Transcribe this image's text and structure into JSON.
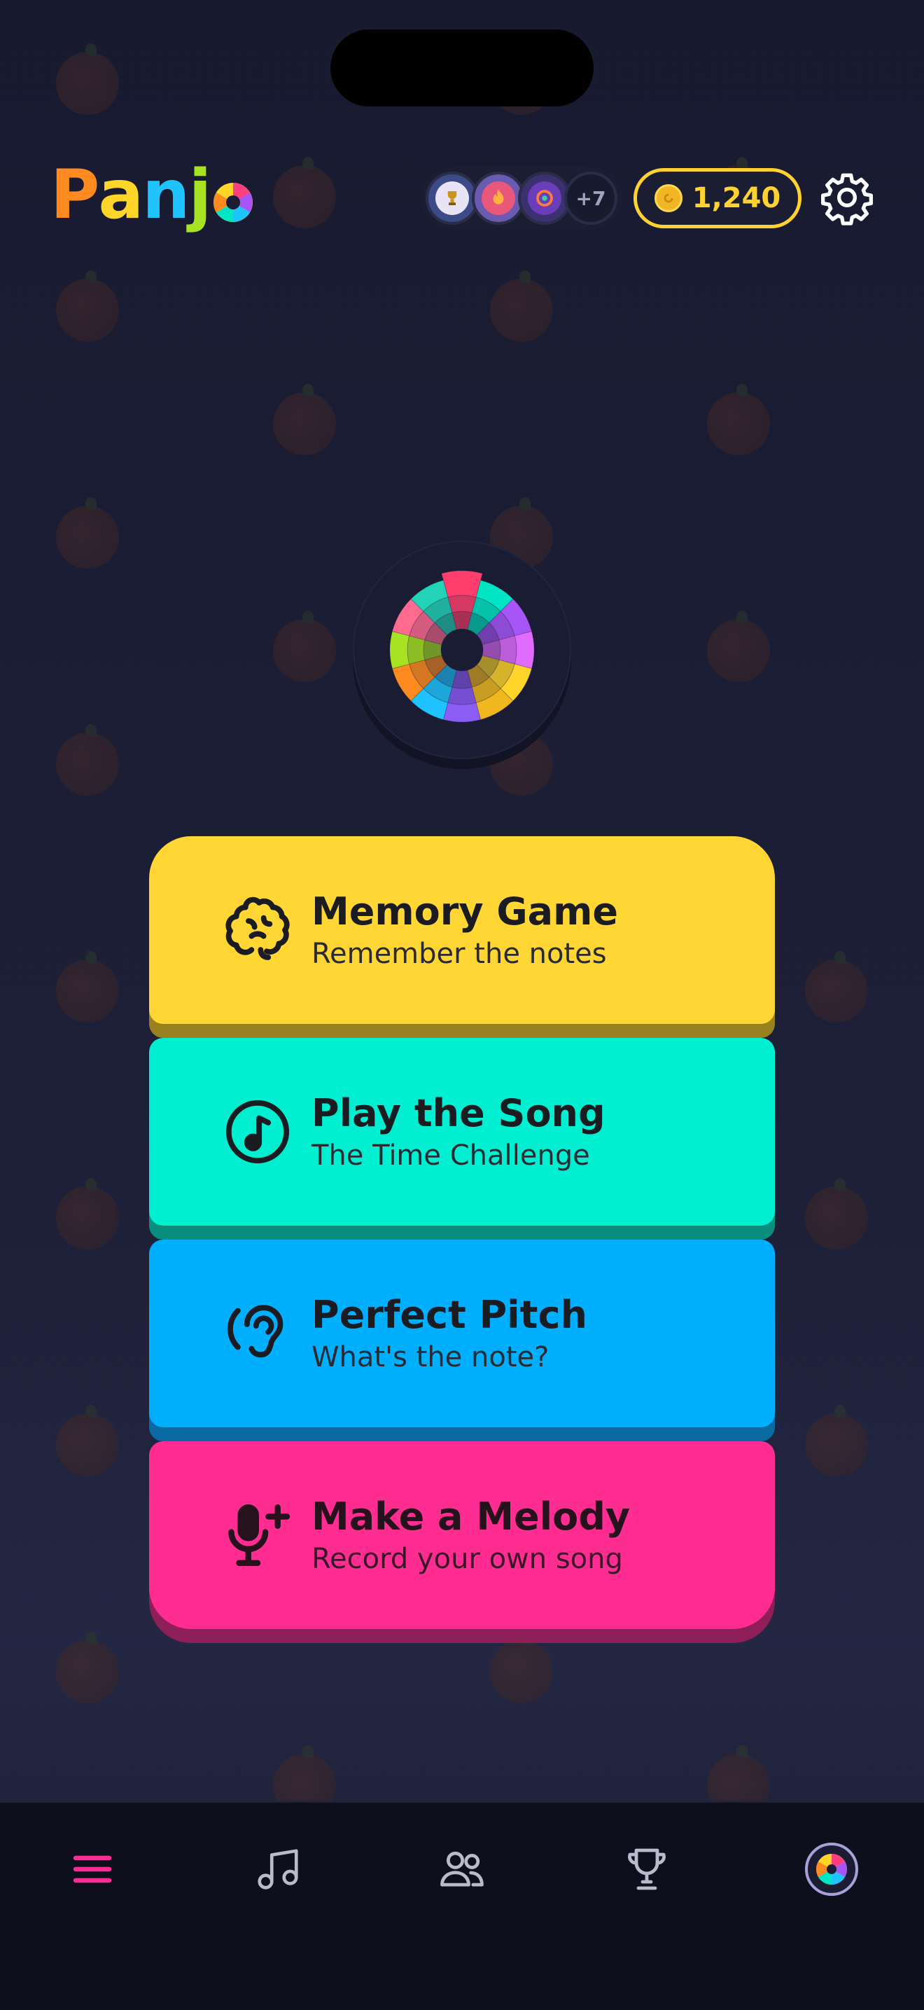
{
  "app": {
    "name": "Panjo",
    "logo_letters": [
      "P",
      "a",
      "n",
      "j"
    ]
  },
  "colors": {
    "background": "#1d2038",
    "accent_yellow": "#ffd634",
    "accent_teal": "#00efd1",
    "accent_blue": "#00b0ff",
    "accent_pink": "#ff2d92",
    "tab_active": "#ff2d92"
  },
  "header": {
    "badges": [
      {
        "icon": "trophy-badge-icon"
      },
      {
        "icon": "flame-badge-icon"
      },
      {
        "icon": "medal-badge-icon"
      }
    ],
    "badges_more": "+7",
    "coins": "1,240",
    "settings_icon": "gear-icon"
  },
  "center": {
    "icon": "color-wheel-icon"
  },
  "modes": [
    {
      "title": "Memory Game",
      "subtitle": "Remember the notes",
      "icon": "brain-icon",
      "color": "#ffd634"
    },
    {
      "title": "Play the Song",
      "subtitle": "The Time Challenge",
      "icon": "music-note-circle-icon",
      "color": "#00efd1"
    },
    {
      "title": "Perfect Pitch",
      "subtitle": "What's the note?",
      "icon": "ear-icon",
      "color": "#00b0ff"
    },
    {
      "title": "Make a Melody",
      "subtitle": "Record your own song",
      "icon": "microphone-plus-icon",
      "color": "#ff2d92"
    }
  ],
  "tabbar": {
    "tabs": [
      {
        "icon": "menu-icon",
        "active": true
      },
      {
        "icon": "music-note-icon",
        "active": false
      },
      {
        "icon": "users-icon",
        "active": false
      },
      {
        "icon": "trophy-icon",
        "active": false
      },
      {
        "icon": "profile-avatar-icon",
        "active": false
      }
    ]
  }
}
